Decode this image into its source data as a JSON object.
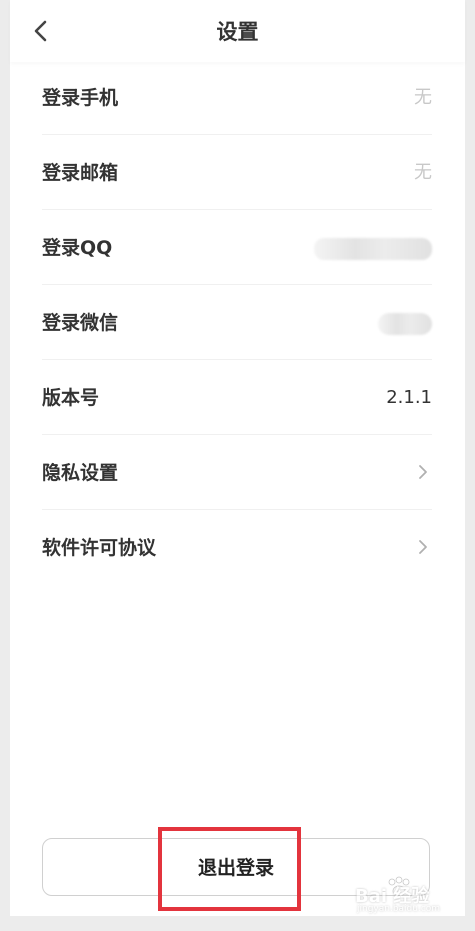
{
  "header": {
    "title": "设置",
    "back_icon": "chevron-left-icon"
  },
  "settings": {
    "items": [
      {
        "label": "登录手机",
        "value": "无",
        "type": "text-muted"
      },
      {
        "label": "登录邮箱",
        "value": "无",
        "type": "text-muted"
      },
      {
        "label": "登录QQ",
        "value": "",
        "type": "blurred"
      },
      {
        "label": "登录微信",
        "value": "",
        "type": "blurred"
      },
      {
        "label": "版本号",
        "value": "2.1.1",
        "type": "text"
      },
      {
        "label": "隐私设置",
        "value": "",
        "type": "chevron"
      },
      {
        "label": "软件许可协议",
        "value": "",
        "type": "chevron"
      }
    ]
  },
  "footer": {
    "logout_label": "退出登录"
  },
  "annotation": {
    "highlight_color": "#e3343d"
  },
  "watermark": {
    "text": "Bai 经验",
    "sub": "jingyan.baidu.com"
  },
  "colors": {
    "background": "#ececec",
    "panel": "#ffffff",
    "label": "#333333",
    "muted": "#c8c8c8",
    "divider": "#f0f0f0"
  }
}
